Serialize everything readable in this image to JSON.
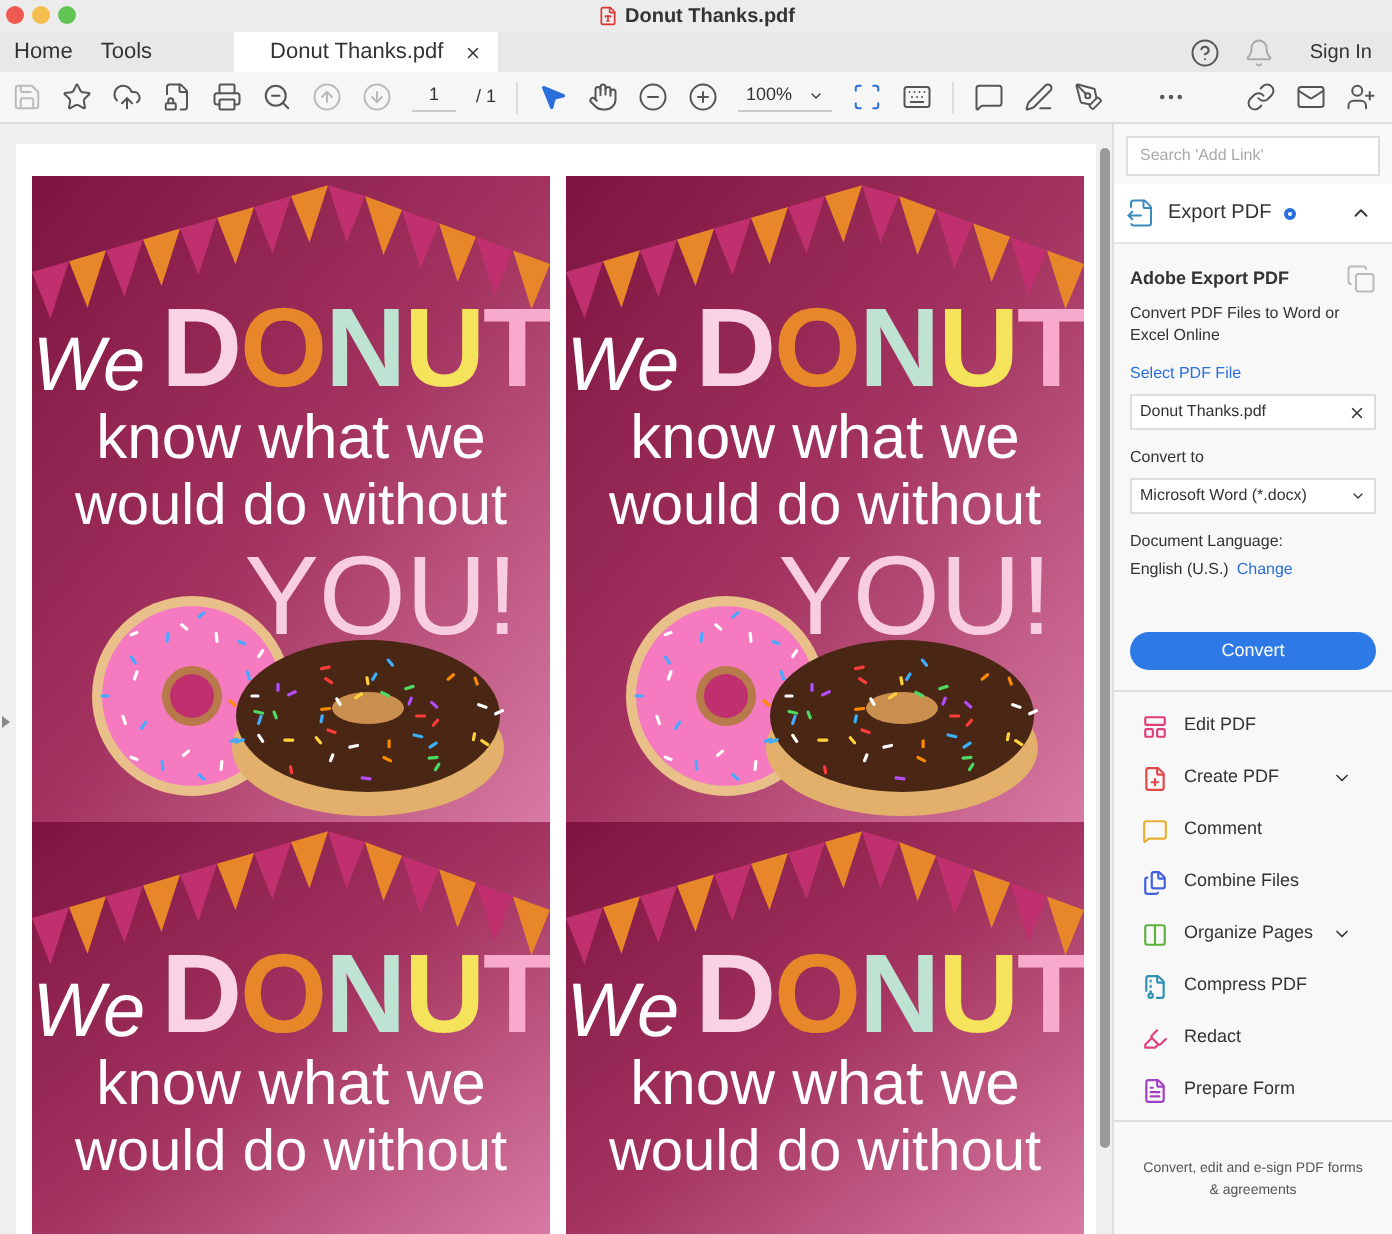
{
  "window": {
    "title": "Donut Thanks.pdf"
  },
  "tabs": [
    {
      "label": "Home",
      "selected": false
    },
    {
      "label": "Tools",
      "selected": false
    },
    {
      "label": "Donut Thanks.pdf",
      "selected": true
    }
  ],
  "account": {
    "sign_in": "Sign In"
  },
  "toolbar": {
    "page_number": "1",
    "page_count": "/ 1",
    "zoom": "100%"
  },
  "document": {
    "cards": [
      {
        "line_1": "We",
        "highlight": "DONUT",
        "line_2": "know what we",
        "line_3": "would do without",
        "line_4": "YOU!"
      },
      {
        "line_1": "We",
        "highlight": "DONUT",
        "line_2": "know what we",
        "line_3": "would do without",
        "line_4": "YOU!"
      },
      {
        "line_1": "We",
        "highlight": "DONUT",
        "line_2": "know what we",
        "line_3": "would do without"
      },
      {
        "line_1": "We",
        "highlight": "DONUT",
        "line_2": "know what we",
        "line_3": "would do without"
      }
    ]
  },
  "right_panel": {
    "search": {
      "placeholder": "Search 'Add Link'"
    },
    "export": {
      "title": "Export PDF",
      "expanded": true,
      "heading": "Adobe Export PDF",
      "description": "Convert PDF Files to Word or Excel Online",
      "select_link": "Select PDF File",
      "file": "Donut Thanks.pdf",
      "convert_to_label": "Convert to",
      "format": "Microsoft Word (*.docx)",
      "language_label": "Document Language:",
      "language": "English (U.S.)",
      "change_link": "Change",
      "convert_button": "Convert"
    },
    "tools": [
      {
        "label": "Edit PDF",
        "expandable": false
      },
      {
        "label": "Create PDF",
        "expandable": true
      },
      {
        "label": "Comment",
        "expandable": false
      },
      {
        "label": "Combine Files",
        "expandable": false
      },
      {
        "label": "Organize Pages",
        "expandable": true
      },
      {
        "label": "Compress PDF",
        "expandable": false
      },
      {
        "label": "Redact",
        "expandable": false
      },
      {
        "label": "Prepare Form",
        "expandable": false
      }
    ],
    "footer": "Convert, edit and e-sign PDF forms & agreements"
  }
}
